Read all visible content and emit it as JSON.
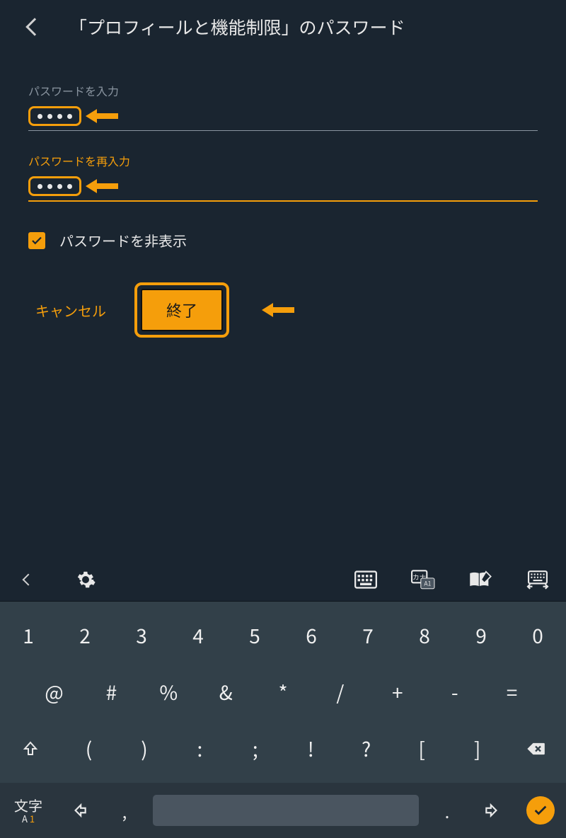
{
  "header": {
    "title": "「プロフィールと機能制限」のパスワード"
  },
  "form": {
    "field1_label": "パスワードを入力",
    "field1_value": "••••",
    "field2_label": "パスワードを再入力",
    "field2_value": "••••",
    "hide_label": "パスワードを非表示",
    "hide_checked": true,
    "cancel_label": "キャンセル",
    "finish_label": "終了"
  },
  "keyboard": {
    "row1": [
      "1",
      "2",
      "3",
      "4",
      "5",
      "6",
      "7",
      "8",
      "9",
      "0"
    ],
    "row2": [
      "@",
      "#",
      "%",
      "&",
      "*",
      "/",
      "+",
      "-",
      "="
    ],
    "row3_left": "shift",
    "row3": [
      "(",
      ")",
      ":",
      ";",
      "!",
      "?",
      "[",
      "]"
    ],
    "row3_right": "backspace",
    "bottom": {
      "mode_top": "文字",
      "mode_bottom_left": "A",
      "mode_bottom_right": "1",
      "comma": ",",
      "period": "."
    }
  }
}
